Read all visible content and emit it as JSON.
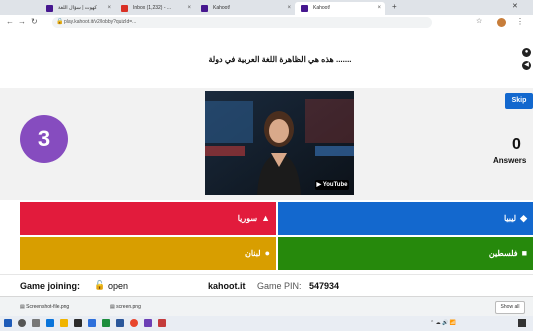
{
  "browser": {
    "tabs": [
      {
        "label": "كهوت | سؤال اللغة",
        "active": false
      },
      {
        "label": "Inbox (1,232) - ..."
      },
      {
        "label": "Kahoot!"
      },
      {
        "label": "Kahoot!",
        "active": true
      }
    ],
    "url": "play.kahoot.it/v2/lobby?quizId=..."
  },
  "question": "....... هذه هي الظاهرة اللغة العربية في دولة",
  "timer": "3",
  "skip_label": "Skip",
  "answers": {
    "count": "0",
    "label": "Answers"
  },
  "video": {
    "youtube_label": "YouTube"
  },
  "options": [
    {
      "label": "سوريا",
      "color": "#e21b3c",
      "shape": "triangle"
    },
    {
      "label": "ليبيا",
      "color": "#1368ce",
      "shape": "diamond"
    },
    {
      "label": "لبنان",
      "color": "#d89e00",
      "shape": "circle"
    },
    {
      "label": "فلسطين",
      "color": "#26890c",
      "shape": "square"
    }
  ],
  "footer": {
    "joining_label": "Game joining:",
    "joining_state": "open",
    "site": "kahoot.it",
    "pin_label": "Game PIN:",
    "pin": "547934"
  },
  "downloads": {
    "items": [
      "Screenshot-file.png",
      "screen.png"
    ],
    "show_all": "Show all"
  }
}
